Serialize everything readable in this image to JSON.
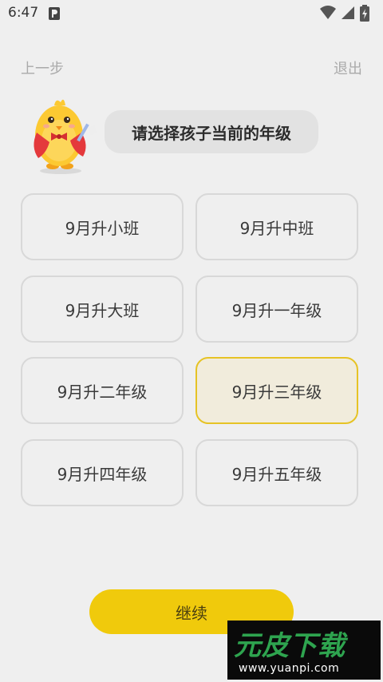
{
  "status_bar": {
    "time": "6:47"
  },
  "nav": {
    "back_label": "上一步",
    "exit_label": "退出"
  },
  "prompt": {
    "text": "请选择孩子当前的年级"
  },
  "grades": {
    "selected_index": 5,
    "options": [
      "9月升小班",
      "9月升中班",
      "9月升大班",
      "9月升一年级",
      "9月升二年级",
      "9月升三年级",
      "9月升四年级",
      "9月升五年级"
    ]
  },
  "continue_button": {
    "label": "继续"
  },
  "watermark": {
    "logo_text": "元皮下载",
    "url": "www.yuanpi.com"
  },
  "colors": {
    "accent": "#f0ca0c",
    "selected_border": "#e6c325",
    "selected_bg": "#f1ecdc",
    "background": "#efefef"
  }
}
